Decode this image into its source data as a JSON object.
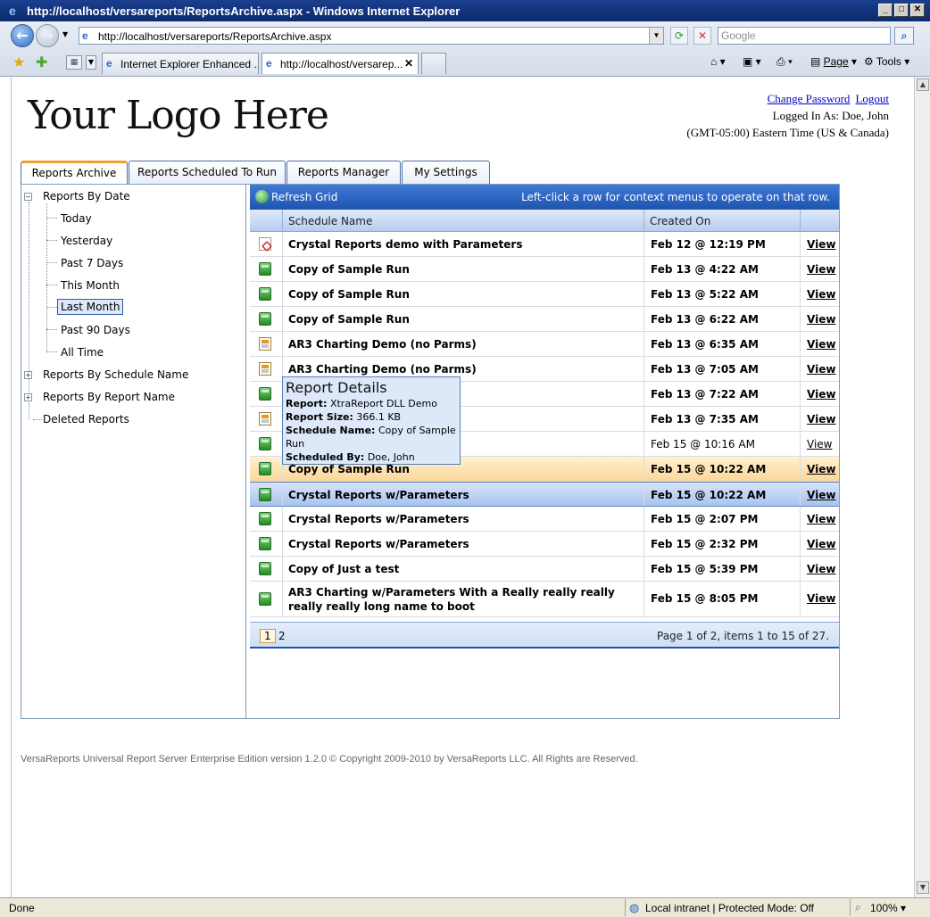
{
  "window": {
    "title": "http://localhost/versareports/ReportsArchive.aspx - Windows Internet Explorer",
    "address": "http://localhost/versareports/ReportsArchive.aspx",
    "search_placeholder": "Google",
    "tabs": [
      {
        "label": "Internet Explorer Enhanced ..."
      },
      {
        "label": "http://localhost/versarep..."
      }
    ],
    "commands": {
      "page": "Page",
      "tools": "Tools"
    },
    "status": "Done",
    "zone": "Local intranet | Protected Mode: Off",
    "zoom": "100%"
  },
  "page": {
    "logo": "Your Logo Here",
    "change_password": "Change Password",
    "logout": "Logout",
    "logged_in": "Logged In As: Doe, John",
    "timezone": "(GMT-05:00) Eastern Time (US & Canada)",
    "tabs": [
      "Reports Archive",
      "Reports Scheduled To Run",
      "Reports Manager",
      "My Settings"
    ],
    "tree": {
      "by_date": "Reports By Date",
      "children": [
        "Today",
        "Yesterday",
        "Past 7 Days",
        "This Month",
        "Last Month",
        "Past 90 Days",
        "All Time"
      ],
      "selected": "Last Month",
      "by_schedule": "Reports By Schedule Name",
      "by_report": "Reports By Report Name",
      "deleted": "Deleted Reports"
    },
    "grid": {
      "refresh": "Refresh Grid",
      "hint": "Left-click a row for context menus to operate on that row.",
      "col_name": "Schedule Name",
      "col_created": "Created On",
      "rows": [
        {
          "icon": "pdf-icon",
          "name": "Crystal Reports demo with Parameters",
          "date": "Feb 12 @ 12:19 PM",
          "view": "View"
        },
        {
          "icon": "report-icon",
          "name": "Copy of Sample Run",
          "date": "Feb 13 @ 4:22 AM",
          "view": "View"
        },
        {
          "icon": "report-icon",
          "name": "Copy of Sample Run",
          "date": "Feb 13 @ 5:22 AM",
          "view": "View"
        },
        {
          "icon": "report-icon",
          "name": "Copy of Sample Run",
          "date": "Feb 13 @ 6:22 AM",
          "view": "View"
        },
        {
          "icon": "chart-report-icon",
          "name": "AR3 Charting Demo (no Parms)",
          "date": "Feb 13 @ 6:35 AM",
          "view": "View"
        },
        {
          "icon": "chart-report-icon",
          "name": "AR3 Charting Demo (no Parms)",
          "date": "Feb 13 @ 7:05 AM",
          "view": "View"
        },
        {
          "icon": "report-icon",
          "name": "",
          "date": "Feb 13 @ 7:22 AM",
          "view": "View"
        },
        {
          "icon": "chart-report-icon",
          "name": "",
          "date": "Feb 13 @ 7:35 AM",
          "view": "View"
        },
        {
          "icon": "report-icon",
          "name": "",
          "date": "Feb 15 @ 10:16 AM",
          "view": "View"
        },
        {
          "icon": "report-icon",
          "name": "Copy of Sample Run",
          "date": "Feb 15 @ 10:22 AM",
          "view": "View"
        },
        {
          "icon": "report-icon",
          "name": "Crystal Reports w/Parameters",
          "date": "Feb 15 @ 10:22 AM",
          "view": "View"
        },
        {
          "icon": "report-icon",
          "name": "Crystal Reports w/Parameters",
          "date": "Feb 15 @ 2:07 PM",
          "view": "View"
        },
        {
          "icon": "report-icon",
          "name": "Crystal Reports w/Parameters",
          "date": "Feb 15 @ 2:32 PM",
          "view": "View"
        },
        {
          "icon": "report-icon",
          "name": "Copy of Just a test",
          "date": "Feb 15 @ 5:39 PM",
          "view": "View"
        },
        {
          "icon": "report-icon",
          "name": "AR3 Charting w/Parameters With a Really really really really really long name to boot",
          "date": "Feb 15 @ 8:05 PM",
          "view": "View"
        }
      ],
      "pager": {
        "current": "1",
        "next": "2",
        "info": "Page 1 of 2, items 1 to 15 of 27."
      }
    },
    "tooltip": {
      "title": "Report Details",
      "report_label": "Report:",
      "report_value": "XtraReport DLL Demo",
      "size_label": "Report Size:",
      "size_value": "366.1 KB",
      "schedule_label": "Schedule Name:",
      "schedule_value": "Copy of Sample Run",
      "by_label": "Scheduled By:",
      "by_value": "Doe, John"
    },
    "footer": "VersaReports Universal Report Server Enterprise Edition version 1.2.0 © Copyright 2009-2010 by VersaReports LLC. All Rights are Reserved."
  }
}
